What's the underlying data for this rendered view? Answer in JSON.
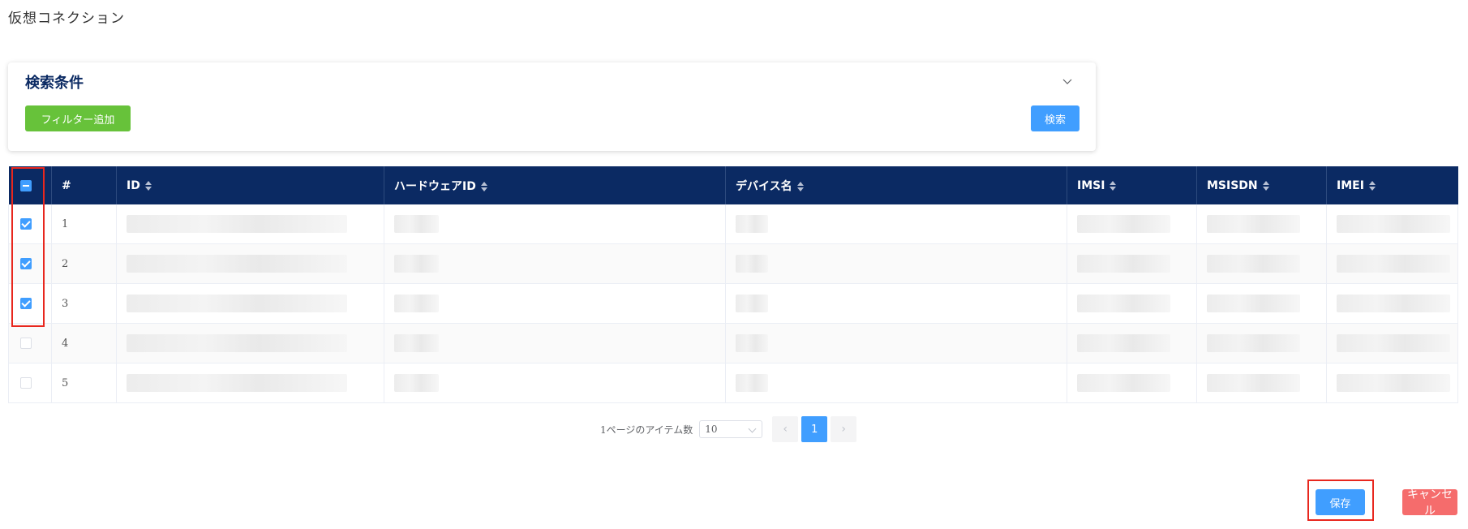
{
  "page": {
    "title": "仮想コネクション"
  },
  "search": {
    "title": "検索条件",
    "add_filter_label": "フィルター追加",
    "search_label": "検索"
  },
  "table": {
    "columns": [
      "#",
      "ID",
      "ハードウェアID",
      "デバイス名",
      "IMSI",
      "MSISDN",
      "IMEI"
    ],
    "rows": [
      {
        "index": "1",
        "checked": true
      },
      {
        "index": "2",
        "checked": true
      },
      {
        "index": "3",
        "checked": true
      },
      {
        "index": "4",
        "checked": false
      },
      {
        "index": "5",
        "checked": false
      }
    ],
    "select_all_state": "indeterminate"
  },
  "pagination": {
    "items_per_page_label": "1ページのアイテム数",
    "page_size": "10",
    "current_page": "1"
  },
  "footer": {
    "save_label": "保存",
    "cancel_label": "キャンセル"
  },
  "colors": {
    "header_bg": "#0b2a63",
    "primary": "#409eff",
    "success": "#67c23a",
    "danger": "#f56c6c",
    "highlight": "#e8271e"
  }
}
